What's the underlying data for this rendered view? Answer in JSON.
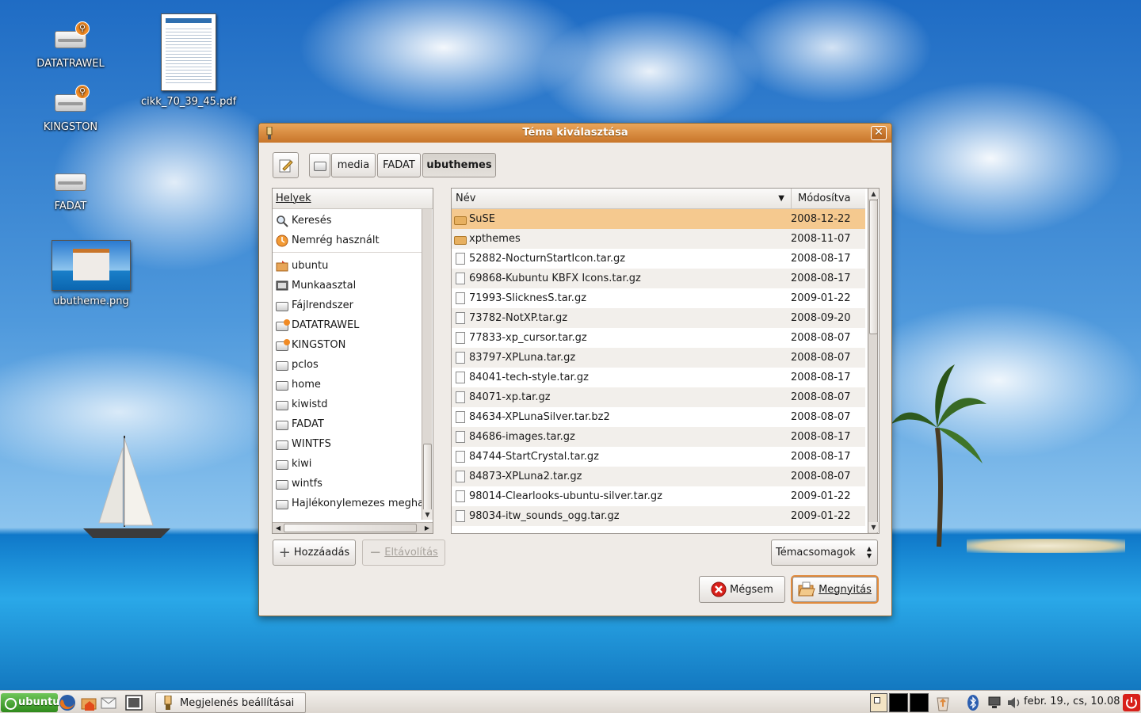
{
  "desktop": {
    "icons": [
      {
        "label": "DATATRAWEL",
        "icon": "usb-drive-icon"
      },
      {
        "label": "KINGSTON",
        "icon": "usb-drive-icon"
      },
      {
        "label": "FADAT",
        "icon": "drive-icon"
      },
      {
        "label": "cikk_70_39_45.pdf",
        "icon": "pdf-document-icon"
      },
      {
        "label": "ubutheme.png",
        "icon": "image-file-icon"
      }
    ]
  },
  "dialog": {
    "title": "Téma kiválasztása",
    "path": [
      "media",
      "FADAT",
      "ubuthemes"
    ],
    "places": {
      "header": "Helyek",
      "items": [
        {
          "label": "Keresés",
          "icon": "search-icon"
        },
        {
          "label": "Nemrég használt",
          "icon": "recent-icon"
        },
        {
          "label": "ubuntu",
          "icon": "home-folder-icon"
        },
        {
          "label": "Munkaasztal",
          "icon": "desktop-icon"
        },
        {
          "label": "Fájlrendszer",
          "icon": "filesystem-icon"
        },
        {
          "label": "DATATRAWEL",
          "icon": "usb-drive-icon"
        },
        {
          "label": "KINGSTON",
          "icon": "usb-drive-icon"
        },
        {
          "label": "pclos",
          "icon": "drive-icon"
        },
        {
          "label": "home",
          "icon": "drive-icon"
        },
        {
          "label": "kiwistd",
          "icon": "drive-icon"
        },
        {
          "label": "FADAT",
          "icon": "drive-icon"
        },
        {
          "label": "WINTFS",
          "icon": "drive-icon"
        },
        {
          "label": "kiwi",
          "icon": "drive-icon"
        },
        {
          "label": "wintfs",
          "icon": "drive-icon"
        },
        {
          "label": "Hajlékonylemezes meghajtó",
          "icon": "floppy-icon"
        }
      ]
    },
    "files": {
      "col_name": "Név",
      "col_modified": "Módosítva",
      "rows": [
        {
          "name": "SuSE",
          "date": "2008-12-22",
          "type": "folder"
        },
        {
          "name": "xpthemes",
          "date": "2008-11-07",
          "type": "folder"
        },
        {
          "name": "52882-NocturnStartIcon.tar.gz",
          "date": "2008-08-17",
          "type": "file"
        },
        {
          "name": "69868-Kubuntu KBFX Icons.tar.gz",
          "date": "2008-08-17",
          "type": "file"
        },
        {
          "name": "71993-SlicknesS.tar.gz",
          "date": "2009-01-22",
          "type": "file"
        },
        {
          "name": "73782-NotXP.tar.gz",
          "date": "2008-09-20",
          "type": "file"
        },
        {
          "name": "77833-xp_cursor.tar.gz",
          "date": "2008-08-07",
          "type": "file"
        },
        {
          "name": "83797-XPLuna.tar.gz",
          "date": "2008-08-07",
          "type": "file"
        },
        {
          "name": "84041-tech-style.tar.gz",
          "date": "2008-08-17",
          "type": "file"
        },
        {
          "name": "84071-xp.tar.gz",
          "date": "2008-08-07",
          "type": "file"
        },
        {
          "name": "84634-XPLunaSilver.tar.bz2",
          "date": "2008-08-07",
          "type": "file"
        },
        {
          "name": "84686-images.tar.gz",
          "date": "2008-08-17",
          "type": "file"
        },
        {
          "name": "84744-StartCrystal.tar.gz",
          "date": "2008-08-17",
          "type": "file"
        },
        {
          "name": "84873-XPLuna2.tar.gz",
          "date": "2008-08-07",
          "type": "file"
        },
        {
          "name": "98014-Clearlooks-ubuntu-silver.tar.gz",
          "date": "2009-01-22",
          "type": "file"
        },
        {
          "name": "98034-itw_sounds_ogg.tar.gz",
          "date": "2009-01-22",
          "type": "file"
        }
      ]
    },
    "buttons": {
      "add": "Hozzáadás",
      "remove": "Eltávolítás",
      "filter": "Témacsomagok",
      "cancel": "Mégsem",
      "open": "Megnyitás"
    }
  },
  "taskbar": {
    "menu": "ubuntu",
    "task": "Megjelenés beállításai",
    "clock": "febr. 19., cs, 10.08"
  },
  "colors": {
    "accent": "#e08a3c",
    "titlebar": "#c8752a",
    "selection": "#f5c98f"
  }
}
